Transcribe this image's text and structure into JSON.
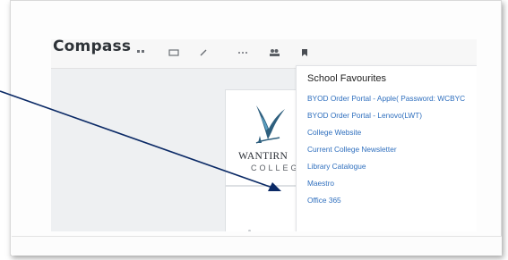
{
  "app": {
    "name": "Compass"
  },
  "toolbar": {
    "icons": [
      "grid-icon",
      "calendar-icon",
      "tools-icon",
      "more-icon",
      "people-icon",
      "favourites-icon"
    ]
  },
  "school": {
    "logo_word": "WANTIRN",
    "logo_sub": "COLLEGE"
  },
  "favourites_menu": {
    "title": "School Favourites",
    "items": [
      "BYOD Order Portal - Apple( Password: WCBYC",
      "BYOD Order Portal - Lenovo(LWT)",
      "College Website",
      "Current College Newsletter",
      "Library Catalogue",
      "Maestro",
      "Office 365"
    ],
    "link_color": "#2f6fbe"
  },
  "annotation": {
    "arrow_color": "#0b2a66",
    "arrow_target": "Maestro"
  }
}
